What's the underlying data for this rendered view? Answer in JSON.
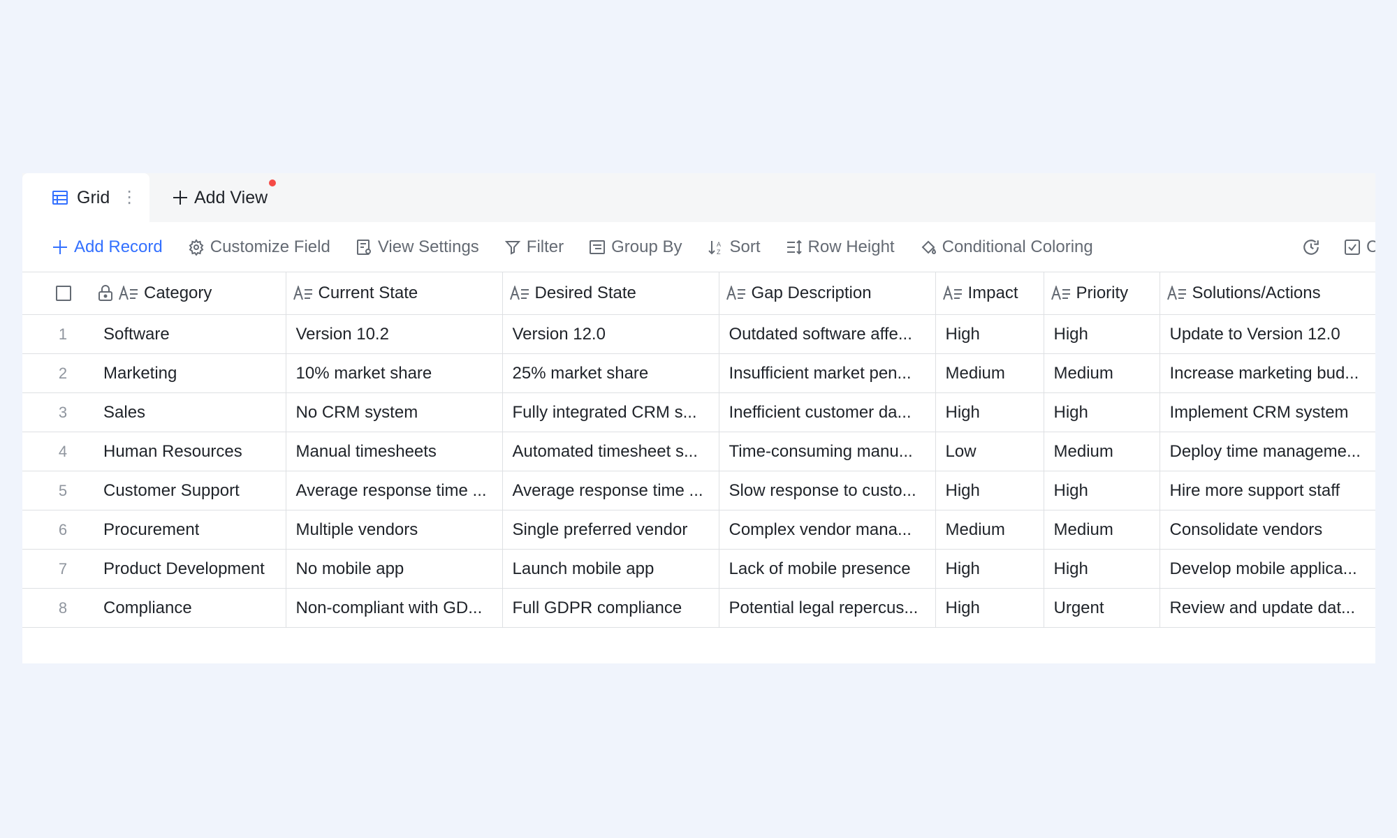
{
  "tabs": {
    "active_label": "Grid",
    "add_view_label": "Add View"
  },
  "toolbar": {
    "add_record": "Add Record",
    "customize_field": "Customize Field",
    "view_settings": "View Settings",
    "filter": "Filter",
    "group_by": "Group By",
    "sort": "Sort",
    "row_height": "Row Height",
    "conditional_coloring": "Conditional Coloring",
    "truncated_right_label": "C"
  },
  "columns": [
    "Category",
    "Current State",
    "Desired State",
    "Gap Description",
    "Impact",
    "Priority",
    "Solutions/Actions"
  ],
  "rows": [
    {
      "num": "1",
      "cells": [
        "Software",
        "Version 10.2",
        "Version 12.0",
        "Outdated software affe...",
        "High",
        "High",
        "Update to Version 12.0"
      ]
    },
    {
      "num": "2",
      "cells": [
        "Marketing",
        "10% market share",
        "25% market share",
        "Insufficient market pen...",
        "Medium",
        "Medium",
        "Increase marketing bud..."
      ]
    },
    {
      "num": "3",
      "cells": [
        "Sales",
        "No CRM system",
        "Fully integrated CRM s...",
        "Inefficient customer da...",
        "High",
        "High",
        "Implement CRM system"
      ]
    },
    {
      "num": "4",
      "cells": [
        "Human Resources",
        "Manual timesheets",
        "Automated timesheet s...",
        "Time-consuming manu...",
        "Low",
        "Medium",
        "Deploy time manageme..."
      ]
    },
    {
      "num": "5",
      "cells": [
        "Customer Support",
        "Average response time ...",
        "Average response time ...",
        "Slow response to custo...",
        "High",
        "High",
        "Hire more support staff"
      ]
    },
    {
      "num": "6",
      "cells": [
        "Procurement",
        "Multiple vendors",
        "Single preferred vendor",
        "Complex vendor mana...",
        "Medium",
        "Medium",
        "Consolidate vendors"
      ]
    },
    {
      "num": "7",
      "cells": [
        "Product Development",
        "No mobile app",
        "Launch mobile app",
        "Lack of mobile presence",
        "High",
        "High",
        "Develop mobile applica..."
      ]
    },
    {
      "num": "8",
      "cells": [
        "Compliance",
        "Non-compliant with GD...",
        "Full GDPR compliance",
        "Potential legal repercus...",
        "High",
        "Urgent",
        "Review and update dat..."
      ]
    }
  ],
  "colors": {
    "accent": "#3370ff",
    "notification": "#f54a45",
    "page_bg": "#f0f4fc",
    "border": "#dee0e3"
  }
}
